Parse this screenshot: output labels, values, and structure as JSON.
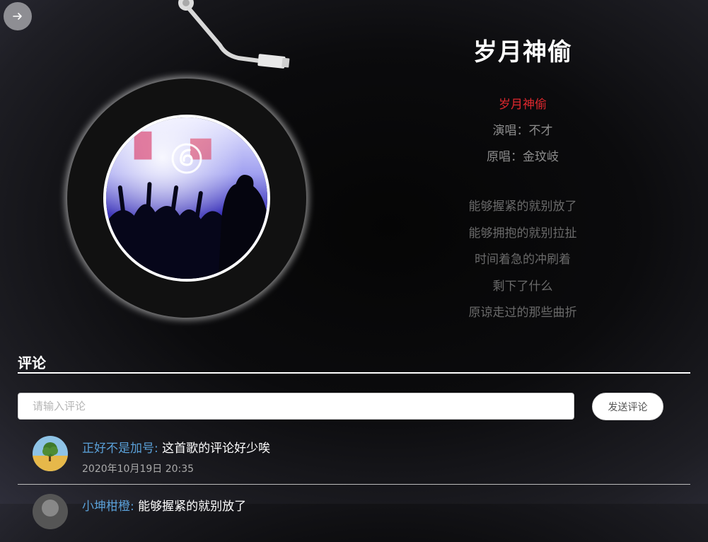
{
  "nav": {
    "back_icon": "arrow-right-icon"
  },
  "player": {
    "needle_icon": "tonearm-needle",
    "cover_logo_icon": "netease-music-logo-icon"
  },
  "song": {
    "title": "岁月神偷",
    "name": "岁月神偷",
    "singer": "演唱：不才",
    "original": "原唱：金玟岐"
  },
  "lyrics": [
    "能够握紧的就别放了",
    "能够拥抱的就别拉扯",
    "时间着急的冲刷着",
    "剩下了什么",
    "原谅走过的那些曲折"
  ],
  "comments_section": {
    "title": "评论",
    "input_placeholder": "请输入评论",
    "input_value": "",
    "send_label": "发送评论"
  },
  "comments": [
    {
      "user": "正好不是加号:",
      "text": "这首歌的评论好少唉",
      "time": "2020年10月19日 20:35"
    },
    {
      "user": "小坤柑橙:",
      "text": "能够握紧的就别放了",
      "time": ""
    }
  ],
  "colors": {
    "accent_red": "#e0282e",
    "username_blue": "#5aa0d8",
    "lyric_gray": "#6a6a6a"
  }
}
